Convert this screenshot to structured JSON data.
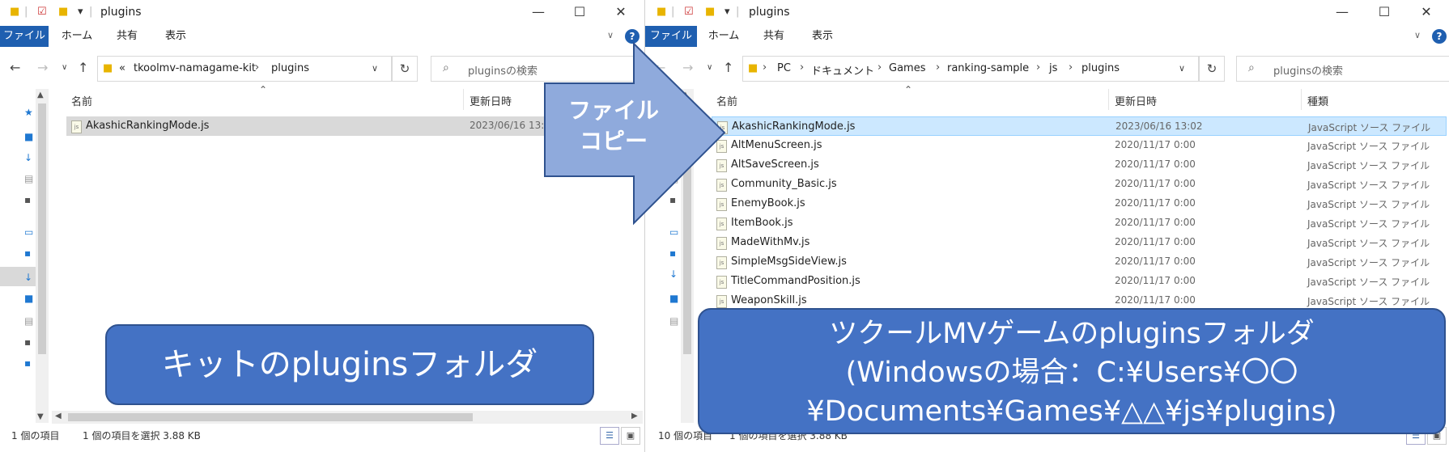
{
  "left": {
    "title": "plugins",
    "ribbon": {
      "file": "ファイル",
      "home": "ホーム",
      "share": "共有",
      "view": "表示",
      "help": "?"
    },
    "breadcrumb": {
      "overflow": "«",
      "items": [
        "tkoolmv-namagame-kit",
        "plugins"
      ]
    },
    "search_placeholder": "pluginsの検索",
    "columns": {
      "name": "名前",
      "date": "更新日時"
    },
    "files": [
      {
        "name": "AkashicRankingMode.js",
        "date": "2023/06/16 13:02"
      }
    ],
    "status_count": "1 個の項目",
    "status_selected": "1 個の項目を選択  3.88 KB"
  },
  "right": {
    "title": "plugins",
    "ribbon": {
      "file": "ファイル",
      "home": "ホーム",
      "share": "共有",
      "view": "表示",
      "help": "?"
    },
    "breadcrumb": {
      "items": [
        "PC",
        "ドキュメント",
        "Games",
        "ranking-sample",
        "js",
        "plugins"
      ]
    },
    "search_placeholder": "pluginsの検索",
    "columns": {
      "name": "名前",
      "date": "更新日時",
      "type": "種類"
    },
    "files": [
      {
        "name": "AkashicRankingMode.js",
        "date": "2023/06/16 13:02",
        "type": "JavaScript ソース ファイル"
      },
      {
        "name": "AltMenuScreen.js",
        "date": "2020/11/17 0:00",
        "type": "JavaScript ソース ファイル"
      },
      {
        "name": "AltSaveScreen.js",
        "date": "2020/11/17 0:00",
        "type": "JavaScript ソース ファイル"
      },
      {
        "name": "Community_Basic.js",
        "date": "2020/11/17 0:00",
        "type": "JavaScript ソース ファイル"
      },
      {
        "name": "EnemyBook.js",
        "date": "2020/11/17 0:00",
        "type": "JavaScript ソース ファイル"
      },
      {
        "name": "ItemBook.js",
        "date": "2020/11/17 0:00",
        "type": "JavaScript ソース ファイル"
      },
      {
        "name": "MadeWithMv.js",
        "date": "2020/11/17 0:00",
        "type": "JavaScript ソース ファイル"
      },
      {
        "name": "SimpleMsgSideView.js",
        "date": "2020/11/17 0:00",
        "type": "JavaScript ソース ファイル"
      },
      {
        "name": "TitleCommandPosition.js",
        "date": "2020/11/17 0:00",
        "type": "JavaScript ソース ファイル"
      },
      {
        "name": "WeaponSkill.js",
        "date": "2020/11/17 0:00",
        "type": "JavaScript ソース ファイル"
      }
    ],
    "status_count": "10 個の項目",
    "status_selected": "1 個の項目を選択  3.88 KB"
  },
  "overlay": {
    "arrow_text_1": "ファイル",
    "arrow_text_2": "コピー",
    "left_callout": "キットのpluginsフォルダ",
    "right_callout_1": "ツクールMVゲームのpluginsフォルダ",
    "right_callout_2": "(Windowsの場合：C:¥Users¥〇〇",
    "right_callout_3": "¥Documents¥Games¥△△¥js¥plugins)",
    "callout_color": "#4472c4",
    "arrow_color": "#8faadc"
  },
  "icons": {
    "folder": "folder-icon",
    "file": "js-file-icon",
    "back": "back-arrow-icon",
    "forward": "forward-arrow-icon",
    "up": "up-arrow-icon",
    "refresh": "refresh-icon",
    "search": "search-icon"
  }
}
